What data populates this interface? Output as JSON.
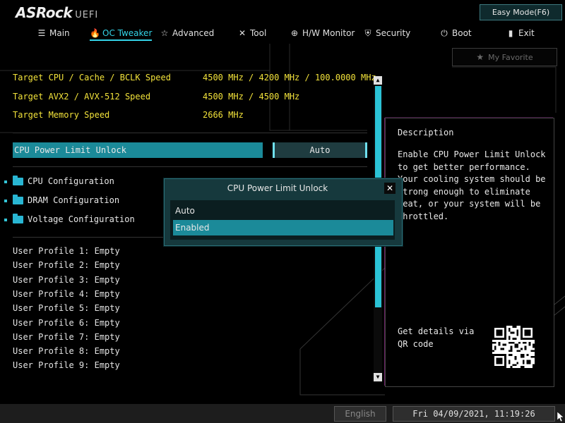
{
  "header": {
    "brand": "ASRock",
    "brand_suffix": "UEFI",
    "easy_mode_label": "Easy Mode(F6)"
  },
  "nav": {
    "items": [
      {
        "label": "Main",
        "icon": "list-icon"
      },
      {
        "label": "OC Tweaker",
        "icon": "flame-icon",
        "active": true
      },
      {
        "label": "Advanced",
        "icon": "star-icon"
      },
      {
        "label": "Tool",
        "icon": "tools-icon"
      },
      {
        "label": "H/W Monitor",
        "icon": "monitor-icon"
      },
      {
        "label": "Security",
        "icon": "shield-icon"
      },
      {
        "label": "Boot",
        "icon": "power-icon"
      },
      {
        "label": "Exit",
        "icon": "exit-icon"
      }
    ]
  },
  "favorite": {
    "label": "My Favorite",
    "icon": "star-icon"
  },
  "targets": [
    {
      "label": "Target CPU / Cache / BCLK Speed",
      "value": "4500 MHz / 4200 MHz / 100.0000 MHz"
    },
    {
      "label": "Target AVX2 / AVX-512 Speed",
      "value": "4500 MHz / 4500 MHz"
    },
    {
      "label": "Target Memory Speed",
      "value": "2666 MHz"
    }
  ],
  "selected_setting": {
    "label": "CPU Power Limit Unlock",
    "value": "Auto"
  },
  "submenus": [
    {
      "label": "CPU Configuration",
      "icon": "folder-icon"
    },
    {
      "label": "DRAM Configuration",
      "icon": "folder-icon"
    },
    {
      "label": "Voltage Configuration",
      "icon": "folder-icon"
    }
  ],
  "profiles": [
    "User Profile 1: Empty",
    "User Profile 2: Empty",
    "User Profile 3: Empty",
    "User Profile 4: Empty",
    "User Profile 5: Empty",
    "User Profile 6: Empty",
    "User Profile 7: Empty",
    "User Profile 8: Empty",
    "User Profile 9: Empty"
  ],
  "description": {
    "title": "Description",
    "text": "Enable CPU Power Limit Unlock to get better performance. Your cooling system should be strong enough to eliminate heat, or your system will be throttled.",
    "qr_label": "Get details via QR code"
  },
  "modal": {
    "title": "CPU Power Limit Unlock",
    "options": [
      "Auto",
      "Enabled"
    ],
    "selected_index": 1
  },
  "footer": {
    "language": "English",
    "datetime": "Fri 04/09/2021, 11:19:26"
  },
  "colors": {
    "accent": "#1b8a99",
    "highlight": "#33d2e6",
    "target_text": "#f2e23a"
  }
}
